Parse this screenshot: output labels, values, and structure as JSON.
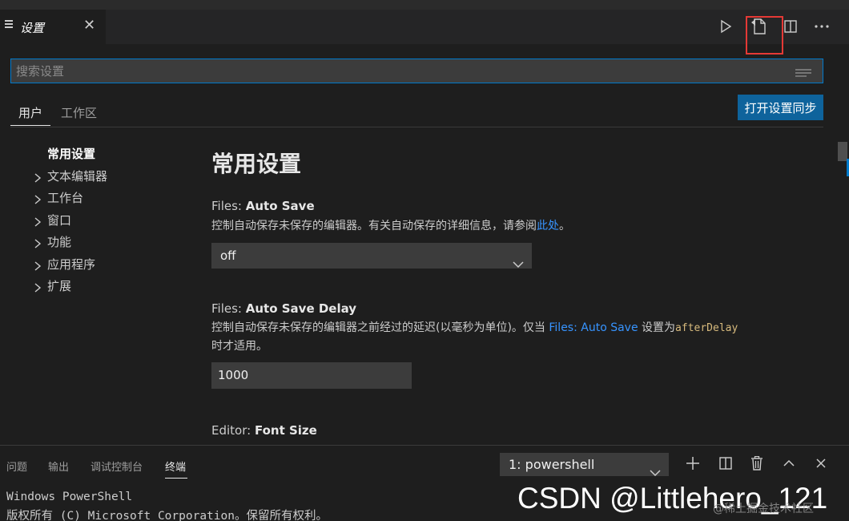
{
  "editor_tab": {
    "title": "设置",
    "close": "✕"
  },
  "search": {
    "placeholder": "搜索设置"
  },
  "scopes": {
    "user": "用户",
    "workspace": "工作区",
    "sync_button": "打开设置同步"
  },
  "toc": {
    "active": "常用设置",
    "items": [
      "文本编辑器",
      "工作台",
      "窗口",
      "功能",
      "应用程序",
      "扩展"
    ]
  },
  "section": {
    "title": "常用设置"
  },
  "settings": {
    "auto_save": {
      "title_prefix": "Files: ",
      "title_name": "Auto Save",
      "desc": "控制自动保存未保存的编辑器。有关自动保存的详细信息，请参阅",
      "link": "此处",
      "desc_end": "。",
      "value": "off"
    },
    "auto_save_delay": {
      "title_prefix": "Files: ",
      "title_name": "Auto Save Delay",
      "desc": "控制自动保存未保存的编辑器之前经过的延迟(以毫秒为单位)。仅当 ",
      "link": "Files: Auto Save",
      "desc_mid": " 设置为",
      "code": "afterDelay",
      "desc_end": "时才适用。",
      "value": "1000"
    },
    "font_size": {
      "title_prefix": "Editor: ",
      "title_name": "Font Size"
    }
  },
  "panel": {
    "tabs": [
      "问题",
      "输出",
      "调试控制台",
      "终端"
    ],
    "terminal_select": "1: powershell",
    "lines": [
      "Windows PowerShell",
      "版权所有 (C) Microsoft Corporation。保留所有权利。"
    ]
  },
  "watermark": {
    "main": "CSDN @Littlehero_121",
    "sub": "@稀土掘金技术社区"
  },
  "colors": {
    "accent": "#007acc",
    "button": "#0e639c",
    "link": "#3794ff",
    "highlight": "#e53935"
  }
}
